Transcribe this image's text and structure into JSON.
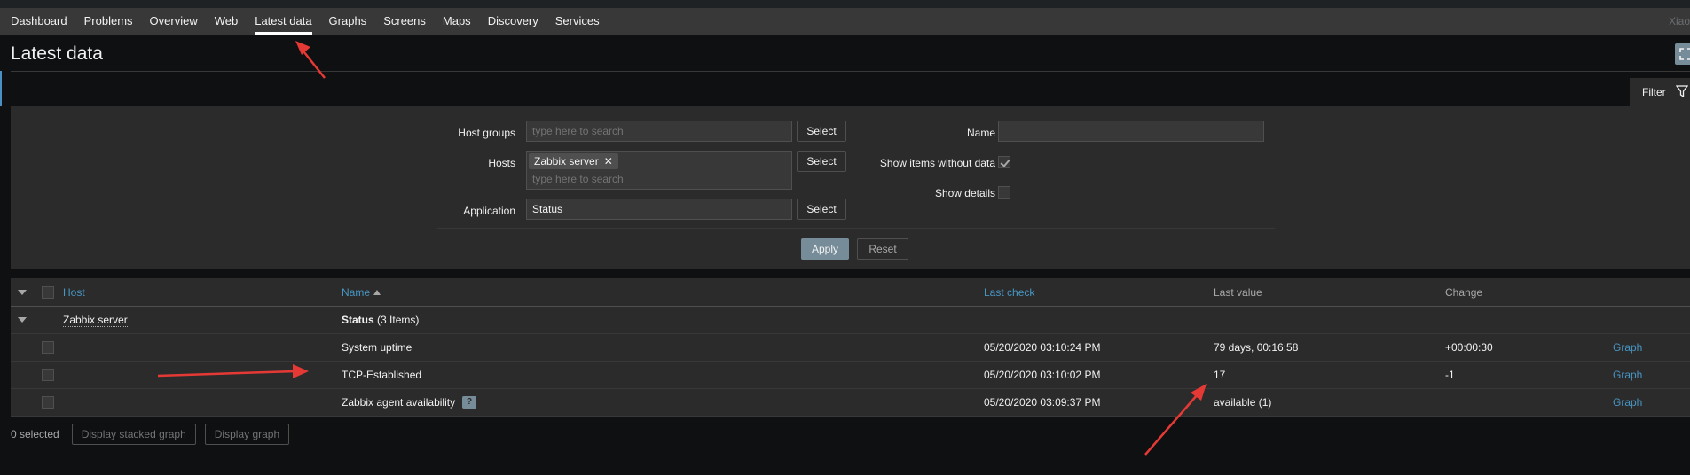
{
  "nav": {
    "items": [
      "Dashboard",
      "Problems",
      "Overview",
      "Web",
      "Latest data",
      "Graphs",
      "Screens",
      "Maps",
      "Discovery",
      "Services"
    ],
    "active": "Latest data",
    "user": "Xiao"
  },
  "page": {
    "title": "Latest data"
  },
  "filter": {
    "tab_label": "Filter",
    "host_groups_label": "Host groups",
    "host_groups_placeholder": "type here to search",
    "hosts_label": "Hosts",
    "hosts_tag": "Zabbix server",
    "hosts_placeholder": "type here to search",
    "application_label": "Application",
    "application_value": "Status",
    "select_label": "Select",
    "name_label": "Name",
    "name_value": "",
    "show_without_data_label": "Show items without data",
    "show_without_data_checked": true,
    "show_details_label": "Show details",
    "show_details_checked": false,
    "apply_label": "Apply",
    "reset_label": "Reset"
  },
  "table": {
    "columns": {
      "host": "Host",
      "name": "Name",
      "last_check": "Last check",
      "last_value": "Last value",
      "change": "Change"
    },
    "group": {
      "host": "Zabbix server",
      "app_name": "Status",
      "app_count": "(3 Items)"
    },
    "rows": [
      {
        "name": "System uptime",
        "last_check": "05/20/2020 03:10:24 PM",
        "last_value": "79 days, 00:16:58",
        "change": "+00:00:30",
        "graph": "Graph"
      },
      {
        "name": "TCP-Established",
        "last_check": "05/20/2020 03:10:02 PM",
        "last_value": "17",
        "change": "-1",
        "graph": "Graph"
      },
      {
        "name": "Zabbix agent availability",
        "last_check": "05/20/2020 03:09:37 PM",
        "last_value": "available (1)",
        "change": "",
        "graph": "Graph"
      }
    ]
  },
  "footer": {
    "selected": "0 selected",
    "stacked_graph": "Display stacked graph",
    "graph": "Display graph"
  },
  "colors": {
    "nav_bg": "#383838",
    "page_bg": "#0e1012",
    "panel_bg": "#2b2b2b",
    "link": "#4796c4",
    "button_primary": "#768d99",
    "annotation_arrow": "#e53935"
  }
}
